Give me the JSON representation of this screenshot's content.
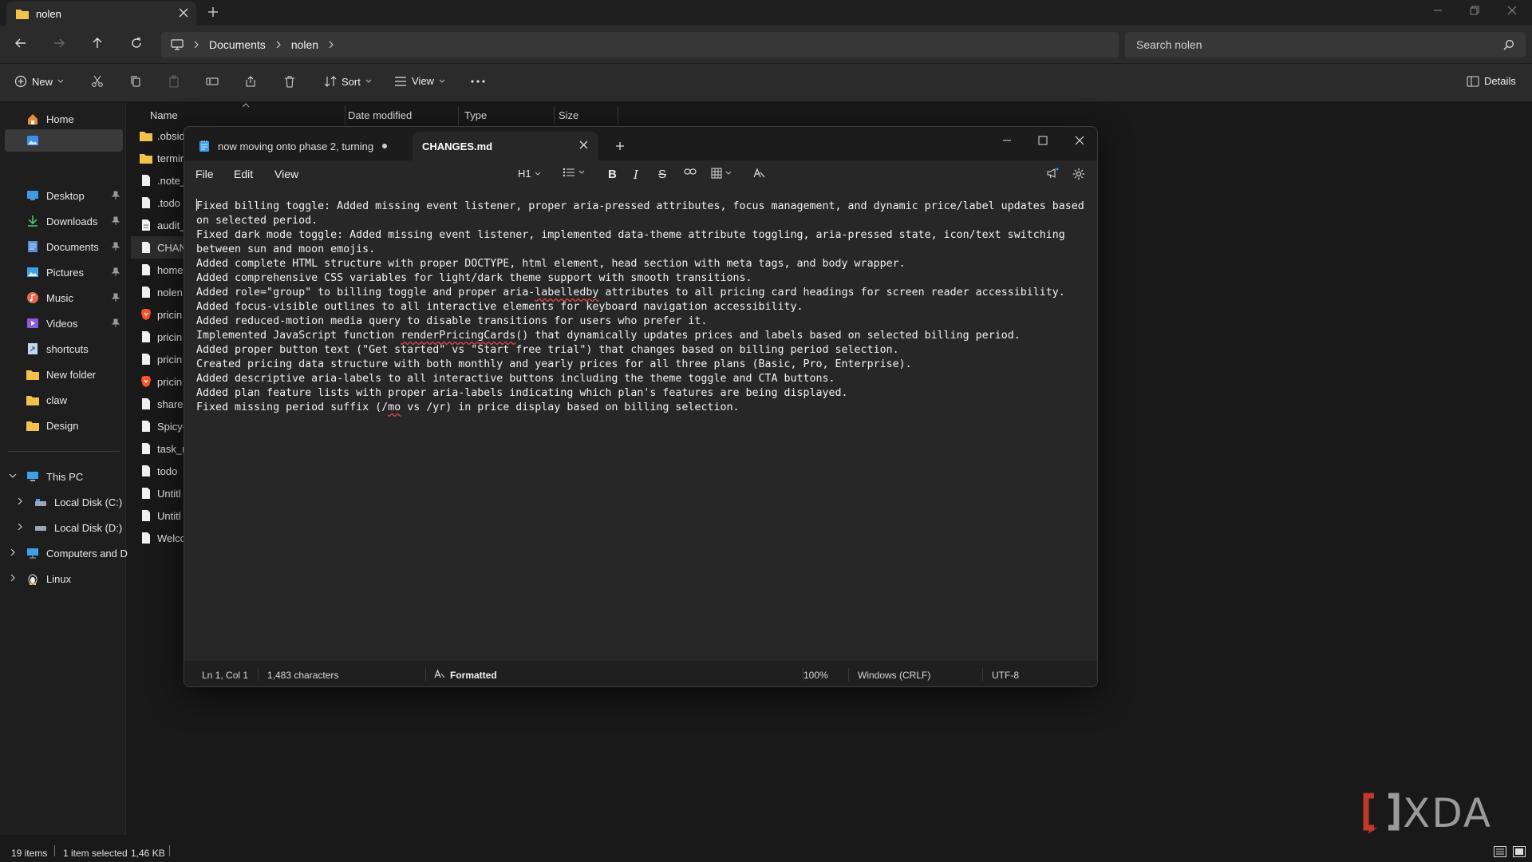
{
  "explorer": {
    "tab_title": "nolen",
    "breadcrumb": [
      "Documents",
      "nolen"
    ],
    "search_placeholder": "Search nolen",
    "commands": {
      "new": "New",
      "sort": "Sort",
      "view": "View",
      "details": "Details"
    },
    "sidebar": {
      "home": "Home",
      "pinned": [
        "Desktop",
        "Downloads",
        "Documents",
        "Pictures",
        "Music",
        "Videos"
      ],
      "folders": [
        "shortcuts",
        "New folder",
        "claw",
        "Design"
      ],
      "this_pc": "This PC",
      "drives": [
        "Local Disk (C:)",
        "Local Disk (D:)"
      ],
      "computers": "Computers and De",
      "linux": "Linux"
    },
    "columns": {
      "name": "Name",
      "date": "Date modified",
      "type": "Type",
      "size": "Size"
    },
    "files": [
      {
        "name": ".obsid",
        "icon": "folder-icon"
      },
      {
        "name": "termir",
        "icon": "folder-icon"
      },
      {
        "name": ".note_",
        "icon": "file-icon"
      },
      {
        "name": ".todo",
        "icon": "file-icon"
      },
      {
        "name": "audit_",
        "icon": "file-icon"
      },
      {
        "name": "CHAN",
        "icon": "file-icon"
      },
      {
        "name": "home",
        "icon": "file-icon"
      },
      {
        "name": "nolen",
        "icon": "file-icon"
      },
      {
        "name": "pricin",
        "icon": "brave-icon"
      },
      {
        "name": "pricin",
        "icon": "file-icon"
      },
      {
        "name": "pricin",
        "icon": "file-icon"
      },
      {
        "name": "pricin",
        "icon": "brave-icon"
      },
      {
        "name": "sharec",
        "icon": "file-icon"
      },
      {
        "name": "Spicy-",
        "icon": "file-icon"
      },
      {
        "name": "task_r",
        "icon": "file-icon"
      },
      {
        "name": "todo",
        "icon": "file-icon"
      },
      {
        "name": "Untitl",
        "icon": "file-icon"
      },
      {
        "name": "Untitl",
        "icon": "file-icon"
      },
      {
        "name": "Welco",
        "icon": "file-icon"
      }
    ],
    "status": {
      "items": "19 items",
      "selected": "1 item selected",
      "size": "1,46 KB"
    }
  },
  "notepad": {
    "tab1": "now moving onto phase 2, turning t",
    "tab2": "CHANGES.md",
    "menu": [
      "File",
      "Edit",
      "View"
    ],
    "heading_select": "H1",
    "content": {
      "l1": "Fixed billing toggle: Added missing event listener, proper aria-pressed attributes, focus management, and dynamic price/label updates based on selected period.",
      "l2": "Fixed dark mode toggle: Added missing event listener, implemented data-theme attribute toggling, aria-pressed state, icon/text switching between sun and moon emojis.",
      "l3": "Added complete HTML structure with proper DOCTYPE, html element, head section with meta tags, and body wrapper.",
      "l4": "Added comprehensive CSS variables for light/dark theme support with smooth transitions.",
      "l5a": "Added role=\"group\" to billing toggle and proper aria-",
      "l5b": "labelledby",
      "l5c": " attributes to all pricing card headings for screen reader accessibility.",
      "l6": "Added focus-visible outlines to all interactive elements for keyboard navigation accessibility.",
      "l7": "Added reduced-motion media query to disable transitions for users who prefer it.",
      "l8a": "Implemented JavaScript function ",
      "l8b": "renderPricingCards",
      "l8c": "() that dynamically updates prices and labels based on selected billing period.",
      "l9": "Added proper button text (\"Get started\" vs \"Start free trial\") that changes based on billing period selection.",
      "l10": "Created pricing data structure with both monthly and yearly prices for all three plans (Basic, Pro, Enterprise).",
      "l11": "Added descriptive aria-labels to all interactive buttons including the theme toggle and CTA buttons.",
      "l12": "Added plan feature lists with proper aria-labels indicating which plan's features are being displayed.",
      "l13a": "Fixed missing period suffix (/",
      "l13b": "mo",
      "l13c": " vs /yr) in price display based on billing selection."
    },
    "status": {
      "position": "Ln 1, Col 1",
      "chars": "1,483 characters",
      "format": "Formatted",
      "zoom": "100%",
      "eol": "Windows (CRLF)",
      "encoding": "UTF-8"
    }
  },
  "watermark": "XDA"
}
